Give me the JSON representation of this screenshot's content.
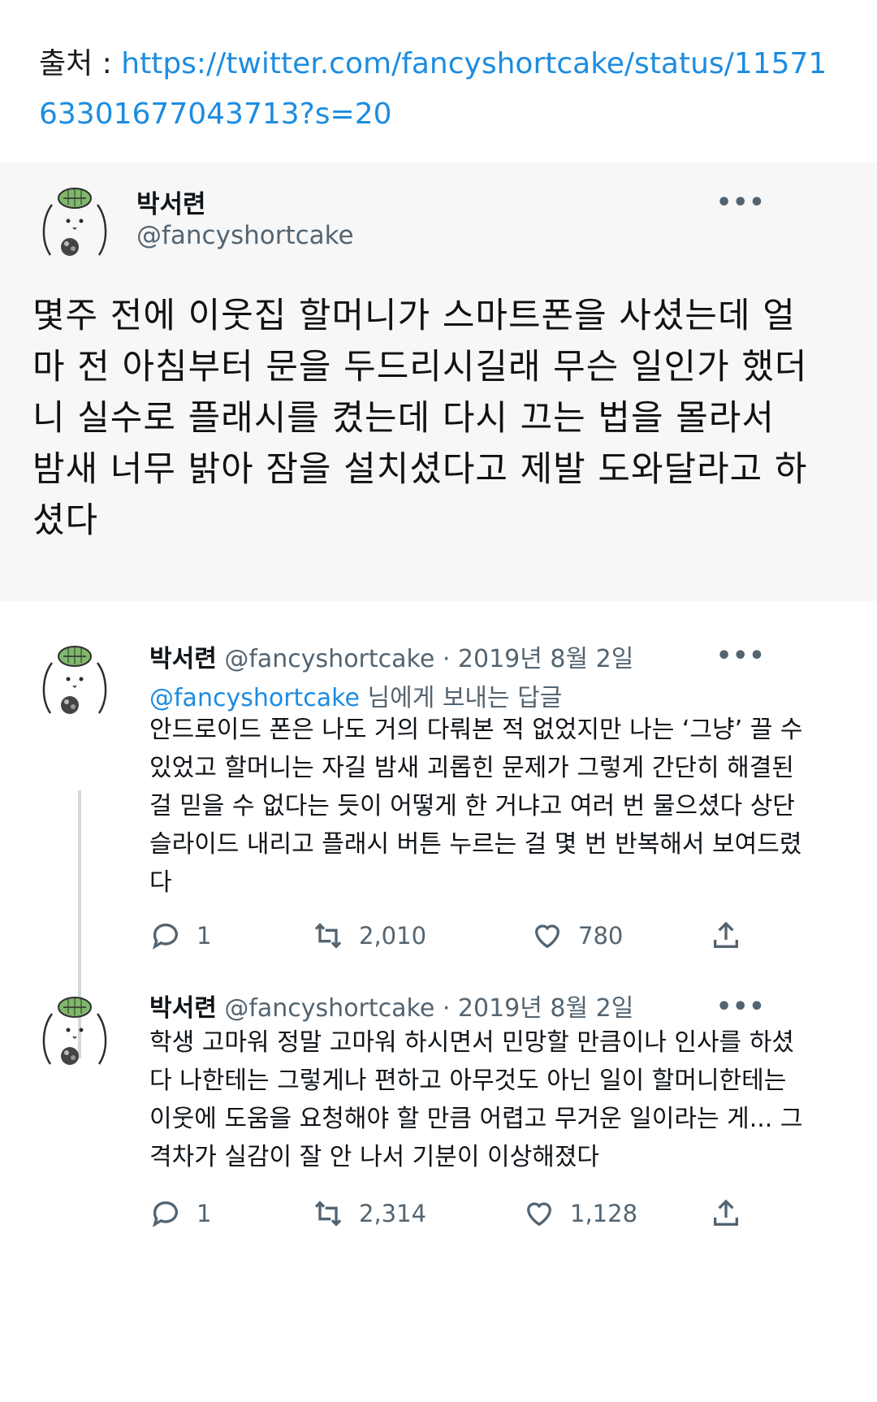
{
  "source": {
    "label": "출처 : ",
    "url": "https://twitter.com/fancyshortcake/status/1157163301677043713?s=20"
  },
  "main_tweet": {
    "name": "박서련",
    "handle": "@fancyshortcake",
    "more": "•••",
    "text": "몇주 전에 이웃집 할머니가 스마트폰을 사셨는데 얼마 전 아침부터 문을 두드리시길래 무슨 일인가 했더니 실수로 플래시를 켰는데 다시 끄는 법을 몰라서 밤새 너무 밝아 잠을 설치셨다고 제발 도와달라고 하셨다"
  },
  "replies": [
    {
      "name": "박서련",
      "meta": " @fancyshortcake · 2019년 8월 2일",
      "more": "•••",
      "replying_mention": "@fancyshortcake",
      "replying_suffix": " 님에게 보내는 답글",
      "text": "안드로이드 폰은 나도 거의 다뤄본 적 없었지만 나는 ‘그냥’ 끌 수 있었고 할머니는 자길 밤새 괴롭힌 문제가 그렇게 간단히 해결된 걸 믿을 수 없다는 듯이 어떻게 한 거냐고 여러 번 물으셨다 상단 슬라이드 내리고 플래시 버튼 누르는 걸 몇 번 반복해서 보여드렸다",
      "replies": "1",
      "retweets": "2,010",
      "likes": "780"
    },
    {
      "name": "박서련",
      "meta": " @fancyshortcake · 2019년 8월 2일",
      "more": "•••",
      "text": "학생 고마워 정말 고마워 하시면서 민망할 만큼이나 인사를 하셨다 나한테는 그렇게나 편하고 아무것도 아닌 일이 할머니한테는 이웃에 도움을 요청해야 할 만큼 어렵고 무거운 일이라는 게... 그 격차가 실감이 잘 안 나서 기분이 이상해졌다",
      "replies": "1",
      "retweets": "2,314",
      "likes": "1,128"
    }
  ],
  "colors": {
    "link": "#1d8ce0",
    "muted": "#536471",
    "card_bg": "#f7f7f7",
    "avatar_cap": "#7fb86a"
  },
  "icons": {
    "avatar": "bear-avatar-icon",
    "reply": "reply-icon",
    "retweet": "retweet-icon",
    "like": "heart-icon",
    "share": "share-icon",
    "more": "more-icon"
  }
}
